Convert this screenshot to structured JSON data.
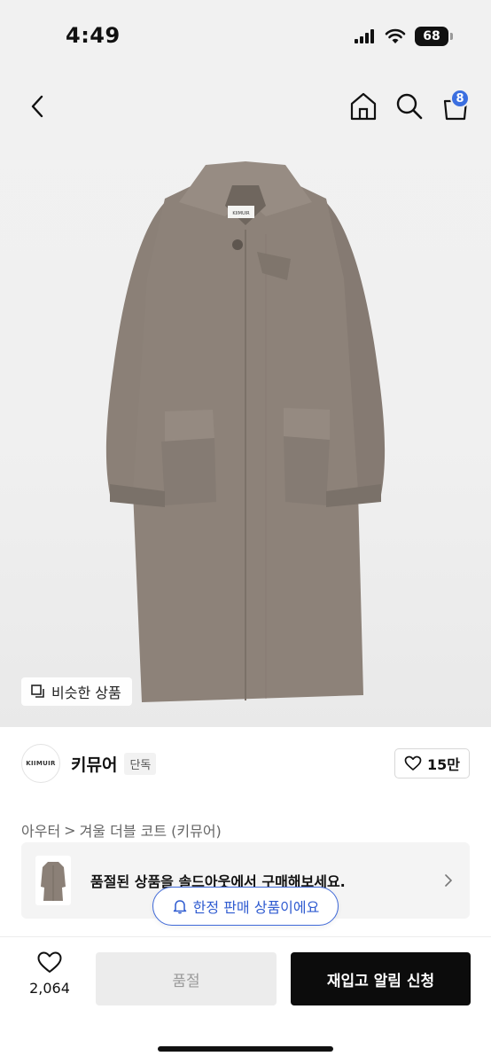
{
  "status": {
    "time": "4:49",
    "battery": "68"
  },
  "nav": {
    "cart_count": "8"
  },
  "hero": {
    "coat_label": "KIIMUIR",
    "similar_label": "비슷한 상품"
  },
  "brand": {
    "logo_text": "KIIMUIR",
    "name": "키뮤어",
    "tag": "단독",
    "likes": "15만"
  },
  "breadcrumb": {
    "category": "아우터",
    "separator": ">",
    "product": "겨울 더블 코트 (키뮤어)"
  },
  "soldout_card": {
    "message": "품절된 상품을 솔드아웃에서 구매해보세요."
  },
  "limited": {
    "label": "한정 판매 상품이에요"
  },
  "bottom": {
    "wish_count": "2,064",
    "soldout_label": "품절",
    "restock_label": "재입고 알림 신청"
  },
  "colors": {
    "accent": "#3b6fe0",
    "coat": "#8b8077",
    "primary_button": "#0c0c0c"
  }
}
